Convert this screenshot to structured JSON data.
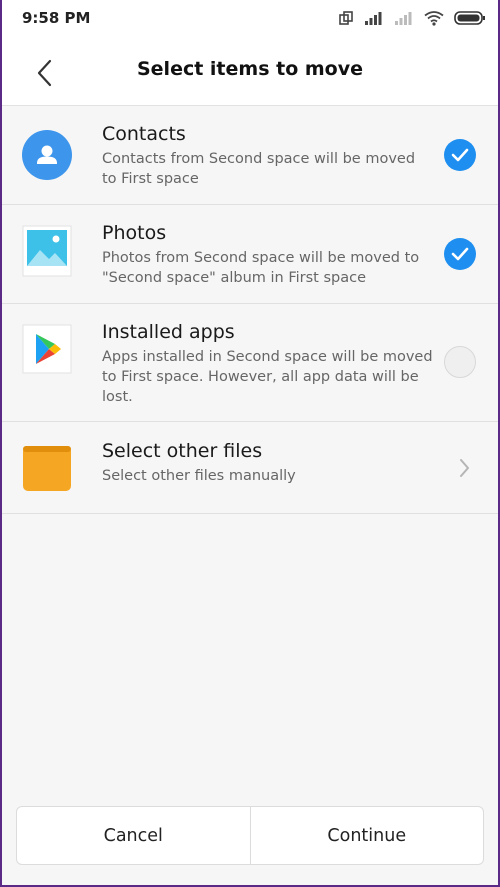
{
  "status": {
    "time": "9:58 PM"
  },
  "header": {
    "title": "Select items to move"
  },
  "items": [
    {
      "title": "Contacts",
      "desc": "Contacts from Second space will be moved to First space",
      "checked": true
    },
    {
      "title": "Photos",
      "desc": "Photos from Second space will be moved to \"Second space\" album in First space",
      "checked": true
    },
    {
      "title": "Installed apps",
      "desc": "Apps installed in Second space will be moved to First space. However, all app data will be lost.",
      "checked": false
    },
    {
      "title": "Select other files",
      "desc": "Select other files manually"
    }
  ],
  "footer": {
    "cancel_label": "Cancel",
    "continue_label": "Continue"
  },
  "colors": {
    "accent": "#1e8ff0",
    "contacts_icon": "#3d95ec",
    "folder_icon": "#f5a623"
  },
  "icons": {
    "back": "chevron-left-icon",
    "contacts": "contacts-icon",
    "photos": "photos-icon",
    "apps": "play-store-icon",
    "files": "folder-icon",
    "checked": "check-icon",
    "forward": "chevron-right-icon"
  }
}
